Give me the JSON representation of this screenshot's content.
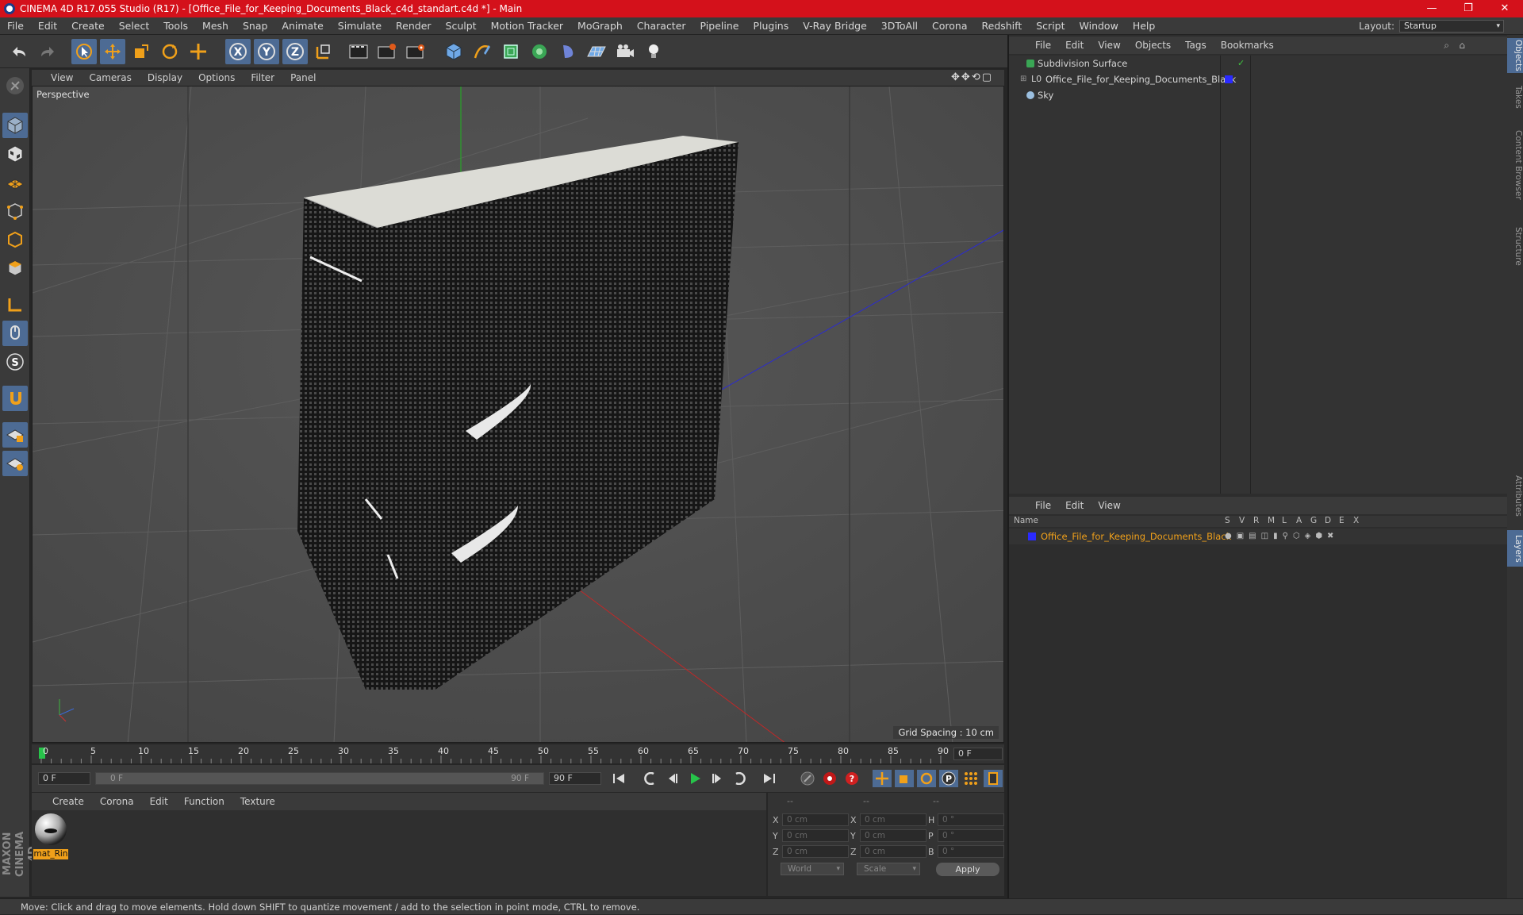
{
  "window": {
    "title": "CINEMA 4D R17.055 Studio (R17) - [Office_File_for_Keeping_Documents_Black_c4d_standart.c4d *] - Main",
    "minimize": "—",
    "maximize": "❐",
    "close": "✕"
  },
  "menu": [
    "File",
    "Edit",
    "Create",
    "Select",
    "Tools",
    "Mesh",
    "Snap",
    "Animate",
    "Simulate",
    "Render",
    "Sculpt",
    "Motion Tracker",
    "MoGraph",
    "Character",
    "Pipeline",
    "Plugins",
    "V-Ray Bridge",
    "3DToAll",
    "Corona",
    "Redshift",
    "Script",
    "Window",
    "Help"
  ],
  "layout": {
    "label": "Layout:",
    "value": "Startup"
  },
  "viewport": {
    "menu": [
      "View",
      "Cameras",
      "Display",
      "Options",
      "Filter",
      "Panel"
    ],
    "label": "Perspective",
    "grid_spacing": "Grid Spacing : 10 cm"
  },
  "timeline": {
    "ticks": [
      "0",
      "5",
      "10",
      "15",
      "20",
      "25",
      "30",
      "35",
      "40",
      "45",
      "50",
      "55",
      "60",
      "65",
      "70",
      "75",
      "80",
      "85",
      "90"
    ],
    "current_frame": "0 F",
    "start_field": "0 F",
    "range_start": "0 F",
    "range_end": "90 F",
    "end_field": "90 F"
  },
  "materials": {
    "menu": [
      "Create",
      "Corona",
      "Edit",
      "Function",
      "Texture"
    ],
    "items": [
      {
        "name": "mat_Rin"
      }
    ]
  },
  "coordinates": {
    "header": [
      "--",
      "--",
      "--"
    ],
    "rows": [
      {
        "a": "X",
        "av": "0 cm",
        "b": "X",
        "bv": "0 cm",
        "c": "H",
        "cv": "0 °"
      },
      {
        "a": "Y",
        "av": "0 cm",
        "b": "Y",
        "bv": "0 cm",
        "c": "P",
        "cv": "0 °"
      },
      {
        "a": "Z",
        "av": "0 cm",
        "b": "Z",
        "bv": "0 cm",
        "c": "B",
        "cv": "0 °"
      }
    ],
    "mode": "World",
    "scale": "Scale",
    "apply": "Apply"
  },
  "objects_panel": {
    "menu": [
      "File",
      "Edit",
      "View",
      "Objects",
      "Tags",
      "Bookmarks"
    ],
    "items": [
      {
        "name": "Subdivision Surface"
      },
      {
        "name": "Office_File_for_Keeping_Documents_Black"
      },
      {
        "name": "Sky"
      }
    ]
  },
  "layers_panel": {
    "menu": [
      "File",
      "Edit",
      "View"
    ],
    "columns": [
      "Name",
      "S",
      "V",
      "R",
      "M",
      "L",
      "A",
      "G",
      "D",
      "E",
      "X"
    ],
    "items": [
      {
        "name": "Office_File_for_Keeping_Documents_Black",
        "color": "#2a2aff"
      }
    ]
  },
  "side_tabs": [
    "Objects",
    "Takes",
    "Content Browser",
    "Structure",
    "Attributes",
    "Layers"
  ],
  "brand": "MAXON CINEMA 4D",
  "status": "Move: Click and drag to move elements. Hold down SHIFT to quantize movement / add to the selection in point mode, CTRL to remove.",
  "colors": {
    "accent": "#4d6b94",
    "title_bar": "#d4111b",
    "highlight": "#f0a01a"
  }
}
